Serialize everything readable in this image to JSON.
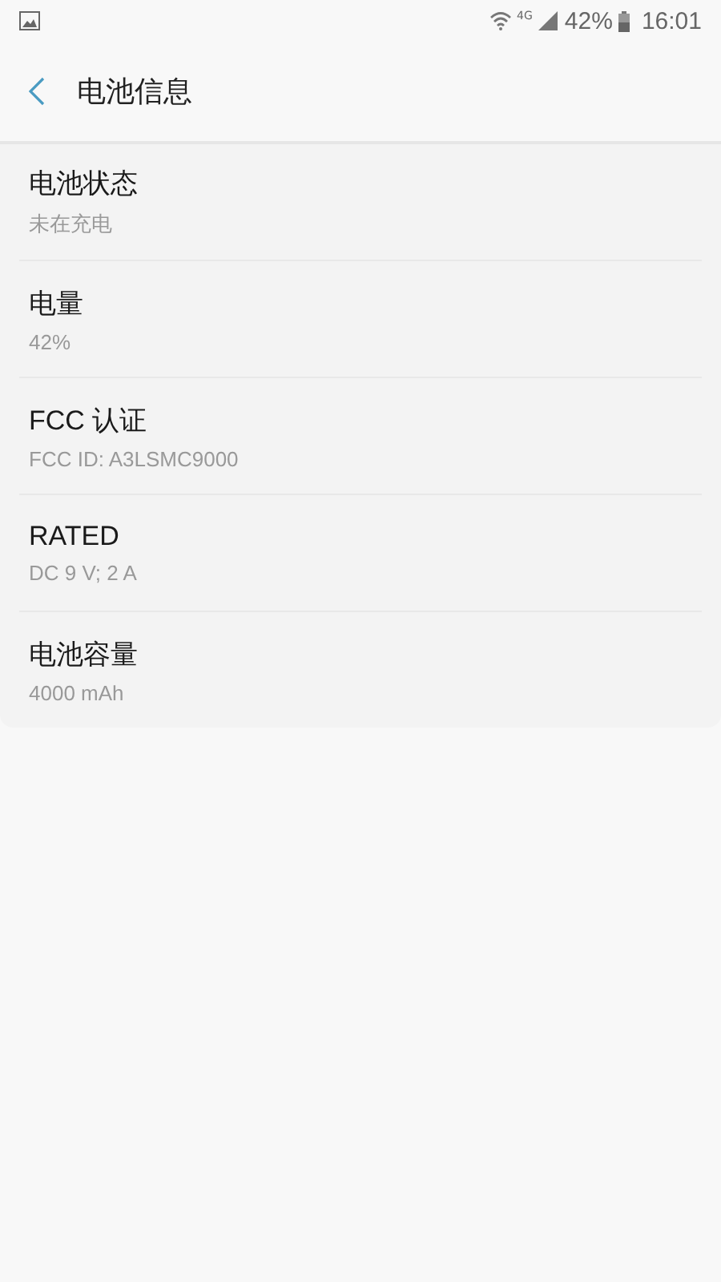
{
  "status_bar": {
    "network": "4G",
    "battery": "42%",
    "time": "16:01"
  },
  "header": {
    "title": "电池信息"
  },
  "items": [
    {
      "title": "电池状态",
      "summary": "未在充电"
    },
    {
      "title": "电量",
      "summary": "42%"
    },
    {
      "title": "FCC 认证",
      "summary": "FCC ID: A3LSMC9000"
    },
    {
      "title": "RATED",
      "summary": "DC 9 V; 2 A"
    },
    {
      "title": "电池容量",
      "summary": "4000 mAh"
    }
  ]
}
